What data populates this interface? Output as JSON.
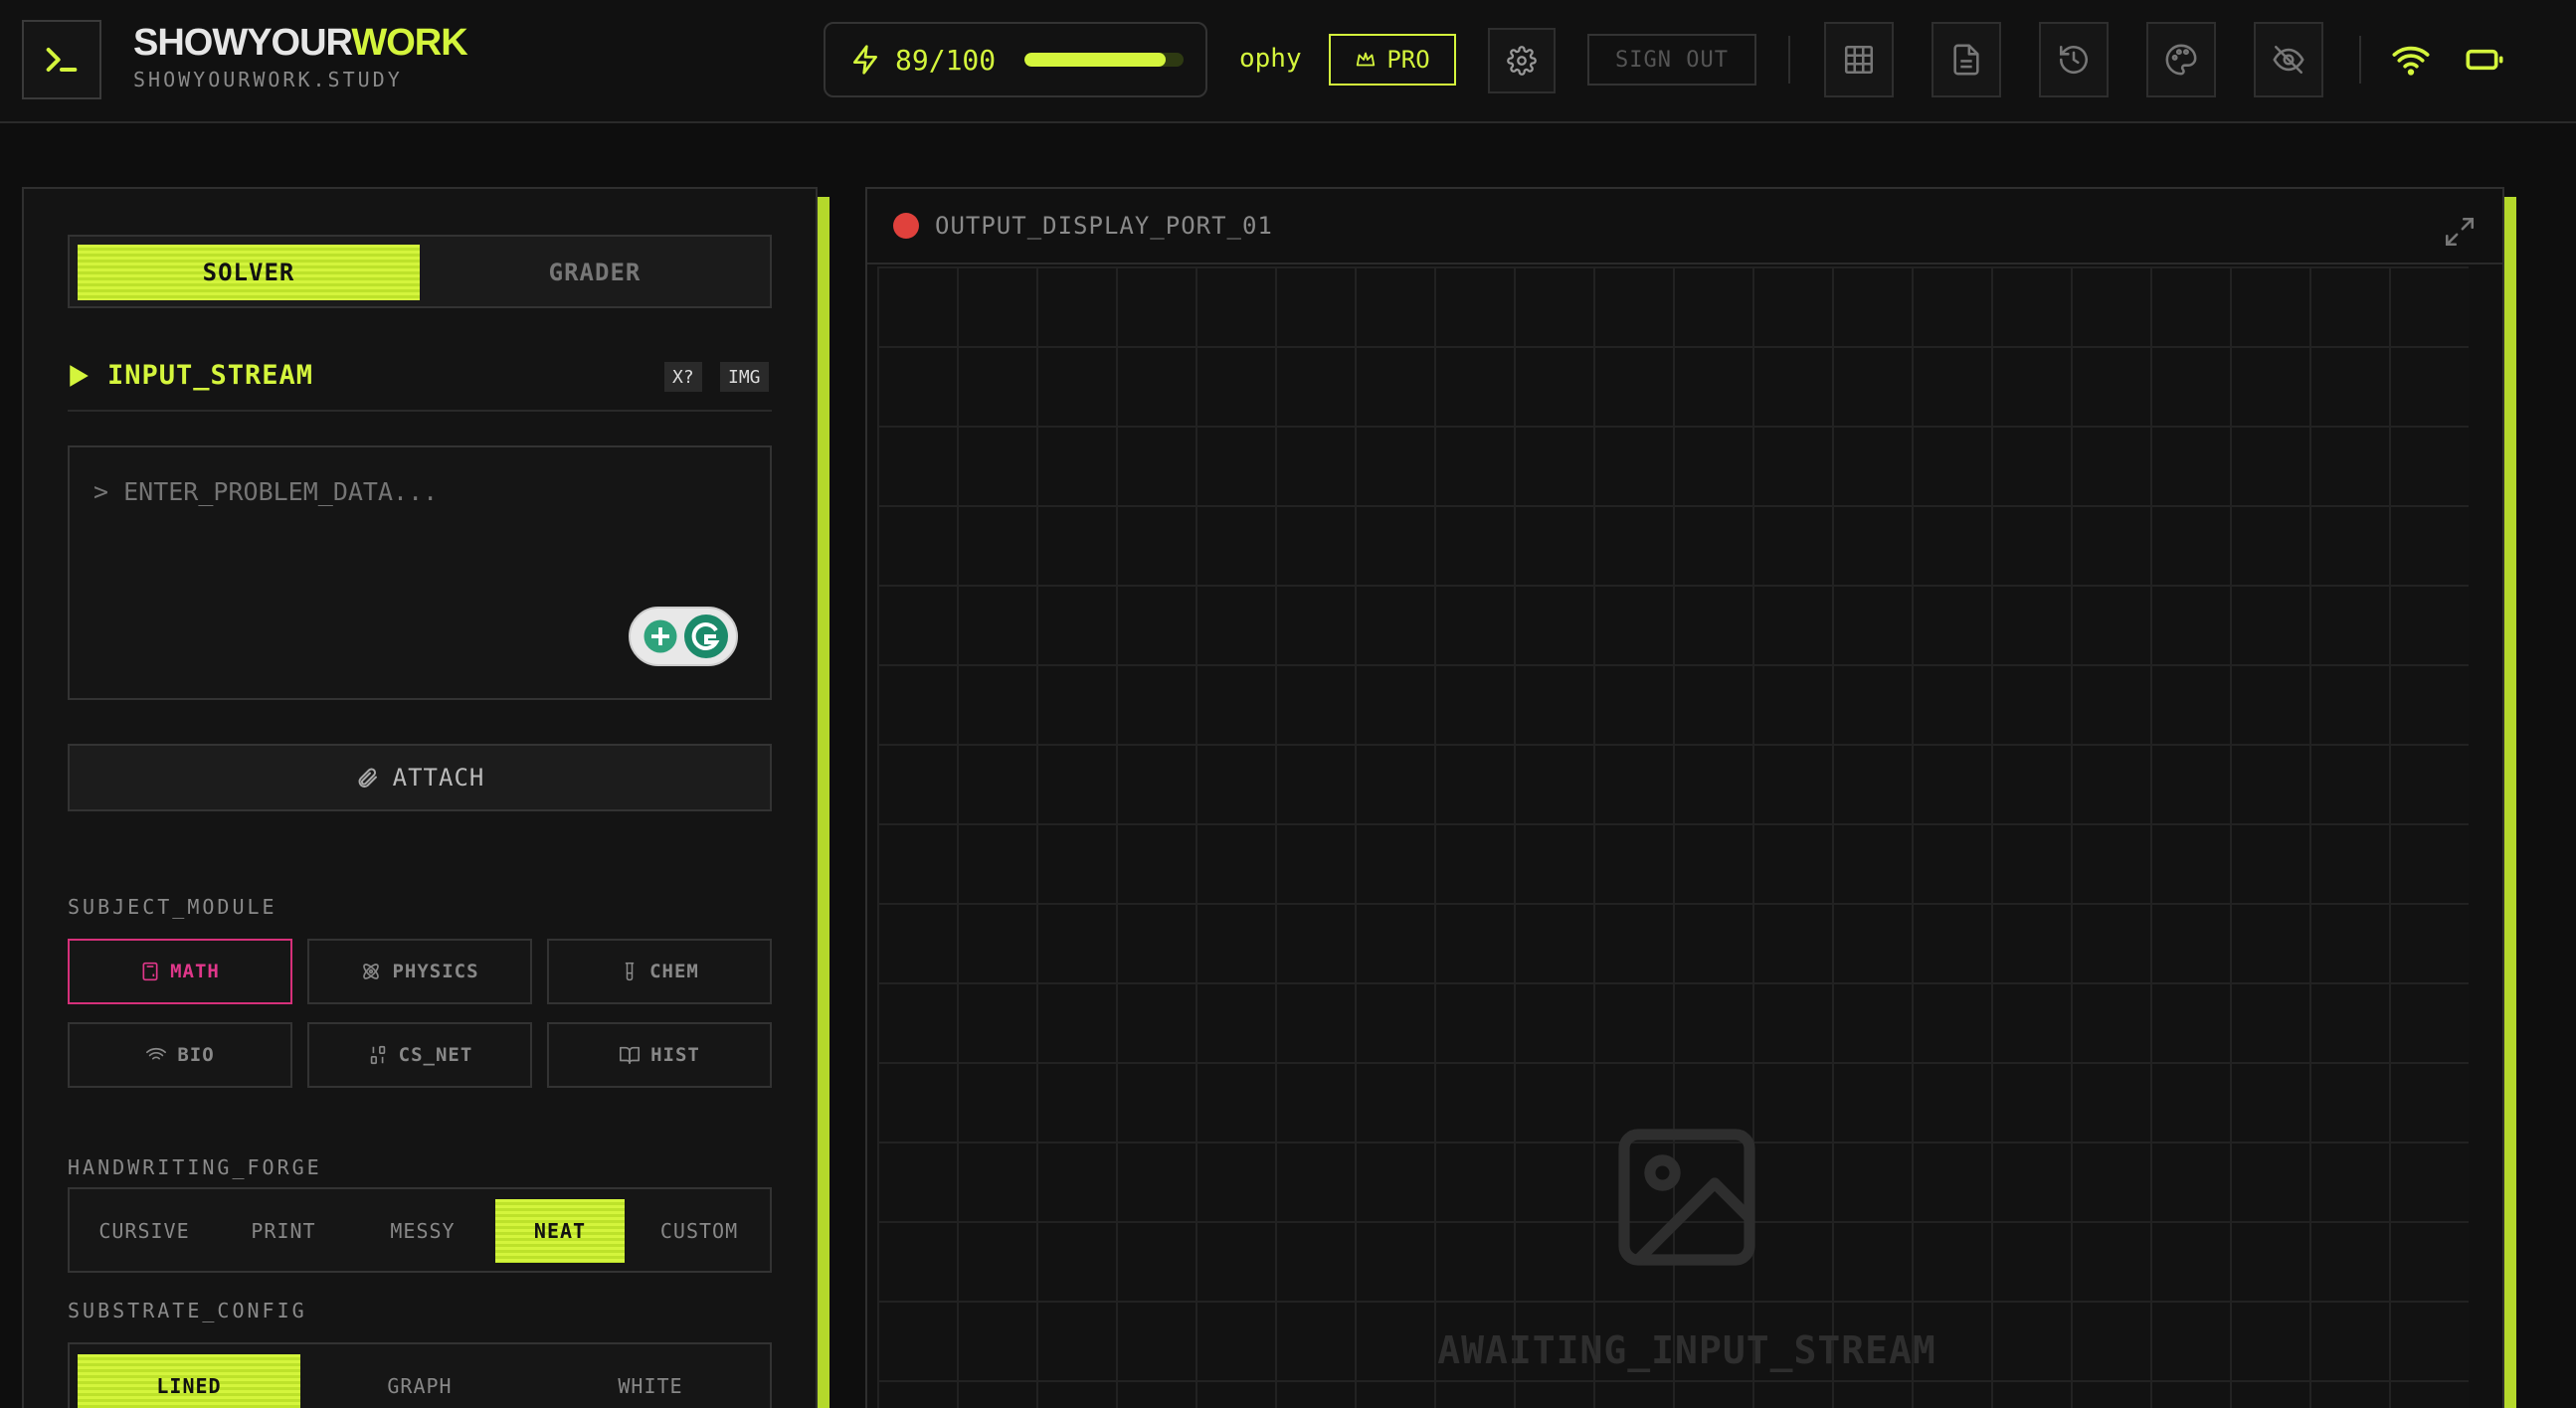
{
  "brand": {
    "title_a": "SHOWYOUR",
    "title_b": "WORK",
    "subtitle": "SHOWYOURWORK.STUDY"
  },
  "credits": {
    "value": "89/100",
    "used": 89,
    "max": 100
  },
  "user": {
    "name": "ophy",
    "plan": "PRO"
  },
  "header": {
    "sign_out": "SIGN OUT"
  },
  "mode": {
    "active": "SOLVER",
    "inactive": "GRADER"
  },
  "input": {
    "title": "INPUT_STREAM",
    "tag1": "X?",
    "tag2": "IMG",
    "placeholder": "> ENTER_PROBLEM_DATA..."
  },
  "attach": {
    "label": "ATTACH"
  },
  "subject": {
    "label": "SUBJECT_MODULE",
    "items": [
      {
        "label": "MATH",
        "icon": "calculator-icon",
        "active": true
      },
      {
        "label": "PHYSICS",
        "icon": "atom-icon",
        "active": false
      },
      {
        "label": "CHEM",
        "icon": "flask-icon",
        "active": false
      },
      {
        "label": "BIO",
        "icon": "wifi-icon",
        "active": false
      },
      {
        "label": "CS_NET",
        "icon": "binary-icon",
        "active": false
      },
      {
        "label": "HIST",
        "icon": "book-icon",
        "active": false
      }
    ]
  },
  "handwriting": {
    "label": "HANDWRITING_FORGE",
    "options": [
      "CURSIVE",
      "PRINT",
      "MESSY",
      "NEAT",
      "CUSTOM"
    ],
    "selected": "NEAT"
  },
  "substrate": {
    "label": "SUBSTRATE_CONFIG",
    "options": [
      "LINED",
      "GRAPH",
      "WHITE"
    ],
    "selected": "LINED"
  },
  "output": {
    "title": "OUTPUT_DISPLAY_PORT_01",
    "status": "AWAITING_INPUT_STREAM"
  },
  "colors": {
    "accent": "#d4f53c",
    "magenta": "#e0378a",
    "record": "#e0413c",
    "bg": "#0e0e0e"
  }
}
